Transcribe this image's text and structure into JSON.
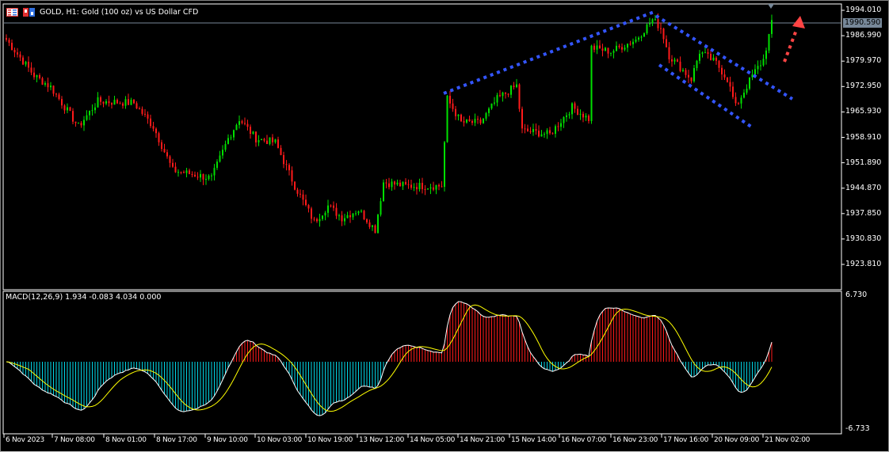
{
  "header": {
    "title": "GOLD, H1:  Gold (100 oz) vs US Dollar CFD",
    "icons": [
      "chart-grid-icon",
      "strategy-tester-icon"
    ]
  },
  "price_axis": {
    "labels": [
      "1994.010",
      "1986.990",
      "1979.970",
      "1972.950",
      "1965.930",
      "1958.910",
      "1951.890",
      "1944.870",
      "1937.850",
      "1930.830",
      "1923.810"
    ],
    "current_price": "1990.590",
    "max": 1994.01,
    "min": 1923.81
  },
  "macd": {
    "label": "MACD(12,26,9) 1.934 -0.083 4.034 0.000",
    "max_label": "6.730",
    "min_label": "-6.733",
    "max": 6.73,
    "min": -6.733,
    "colors": {
      "up": "#ff1a1a",
      "down": "#00d8e8",
      "main": "#ffffff",
      "signal": "#ffff00"
    }
  },
  "time_axis": [
    "6 Nov 2023",
    "7 Nov 08:00",
    "8 Nov 01:00",
    "8 Nov 17:00",
    "9 Nov 10:00",
    "10 Nov 03:00",
    "10 Nov 19:00",
    "13 Nov 12:00",
    "14 Nov 05:00",
    "14 Nov 21:00",
    "15 Nov 14:00",
    "16 Nov 07:00",
    "16 Nov 23:00",
    "17 Nov 16:00",
    "20 Nov 09:00",
    "21 Nov 02:00"
  ],
  "colors": {
    "bull": "#00e000",
    "bear": "#ff1a1a",
    "trendline": "#3355ff",
    "arrow": "#ff4444"
  },
  "price_path": [
    [
      0,
      1985.9
    ],
    [
      10,
      1976
    ],
    [
      16,
      1972.8
    ],
    [
      26,
      1961.9
    ],
    [
      33,
      1968.9
    ],
    [
      46,
      1968.4
    ],
    [
      53,
      1961.9
    ],
    [
      60,
      1949.8
    ],
    [
      74,
      1947.6
    ],
    [
      80,
      1958.6
    ],
    [
      84,
      1964
    ],
    [
      90,
      1958.6
    ],
    [
      97,
      1957.5
    ],
    [
      104,
      1945.5
    ],
    [
      111,
      1935.6
    ],
    [
      116,
      1940
    ],
    [
      121,
      1936.7
    ],
    [
      127,
      1938.9
    ],
    [
      133,
      1933.4
    ],
    [
      136,
      1946.5
    ],
    [
      144,
      1945.5
    ],
    [
      157,
      1945.5
    ],
    [
      159,
      1969.5
    ],
    [
      164,
      1963
    ],
    [
      171,
      1963
    ],
    [
      177,
      1969.5
    ],
    [
      184,
      1973.2
    ],
    [
      186,
      1960.8
    ],
    [
      196,
      1959.7
    ],
    [
      204,
      1967.3
    ],
    [
      210,
      1964
    ],
    [
      211,
      1983.7
    ],
    [
      218,
      1982.6
    ],
    [
      227,
      1985.9
    ],
    [
      233,
      1991.4
    ],
    [
      236,
      1989.2
    ],
    [
      239,
      1981.5
    ],
    [
      247,
      1975
    ],
    [
      250,
      1982.6
    ],
    [
      256,
      1979.4
    ],
    [
      260,
      1975
    ],
    [
      263,
      1967.3
    ],
    [
      269,
      1976
    ],
    [
      273,
      1980.4
    ],
    [
      276,
      1990.3
    ]
  ]
}
